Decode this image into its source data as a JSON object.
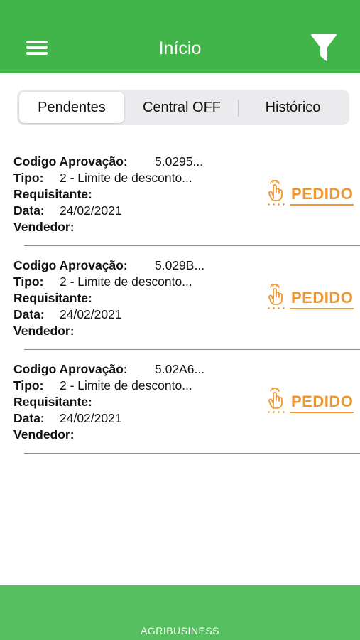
{
  "header": {
    "title": "Início",
    "menu_icon": "hamburger-menu-icon",
    "filter_icon": "filter-funnel-icon",
    "color": "#42b54a"
  },
  "tabs": [
    {
      "label": "Pendentes",
      "active": true
    },
    {
      "label": "Central OFF",
      "active": false
    },
    {
      "label": "Histórico",
      "active": false
    }
  ],
  "labels": {
    "codigo": "Codigo Aprovação:",
    "tipo": "Tipo:",
    "requisitante": "Requisitante:",
    "data": "Data:",
    "vendedor": "Vendedor:"
  },
  "items": [
    {
      "codigo": "5.0295...",
      "tipo": "2 - Limite de desconto...",
      "requisitante": "",
      "data": "24/02/2021",
      "vendedor": "",
      "action_label": "PEDIDO"
    },
    {
      "codigo": "5.029B...",
      "tipo": "2 - Limite de desconto...",
      "requisitante": "",
      "data": "24/02/2021",
      "vendedor": "",
      "action_label": "PEDIDO"
    },
    {
      "codigo": "5.02A6...",
      "tipo": "2 - Limite de desconto...",
      "requisitante": "",
      "data": "24/02/2021",
      "vendedor": "",
      "action_label": "PEDIDO"
    }
  ],
  "action_icon": "tap-hand-icon",
  "accent_color": "#f0962f",
  "footer": {
    "text": "AGRIBUSINESS",
    "color": "#56bf5f"
  }
}
